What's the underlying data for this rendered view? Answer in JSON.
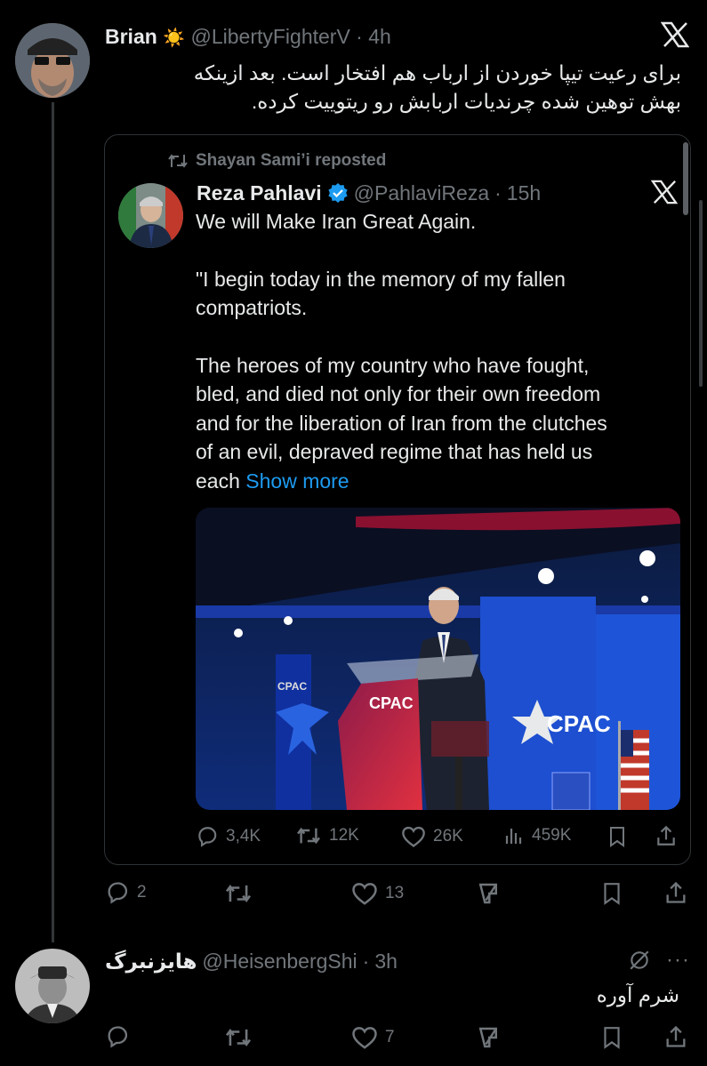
{
  "post1": {
    "display_name": "Brian",
    "name_emoji": "☀️",
    "handle": "@LibertyFighterV",
    "time": "4h",
    "text_line1": "برای رعیت تیپا خوردن از ارباب هم افتخار است. بعد ازینکه",
    "text_line2": "بهش توهین شده چرندیات اربابش رو ریتوییت کرده.",
    "stats": {
      "replies": "2",
      "retweets": "",
      "likes": "13"
    }
  },
  "quoted": {
    "repost_label": "Shayan Sami’i reposted",
    "display_name": "Reza Pahlavi",
    "handle": "@PahlaviReza",
    "time": "15h",
    "p1": "We will Make Iran Great Again.",
    "p2_l1": "\"I begin today in the memory of my fallen",
    "p2_l2": "compatriots.",
    "p3_l1": "The heroes of my country who have fought,",
    "p3_l2": "bled, and died not only for their own freedom",
    "p3_l3": "and for the liberation of Iran from the clutches",
    "p3_l4": "of an evil, depraved regime that has held us",
    "p3_l5": "each",
    "show_more": "Show more",
    "image_text": {
      "cpac_podium": "CPAC",
      "cpac_screen": "CPAC",
      "cpac_banner": "CPAC"
    },
    "stats": {
      "replies": "3,4K",
      "retweets": "12K",
      "likes": "26K",
      "views": "459K"
    }
  },
  "post2": {
    "display_name": "هایزنبرگ",
    "handle": "@HeisenbergShi",
    "time": "3h",
    "text": "شرم آوره",
    "stats": {
      "replies": "",
      "retweets": "",
      "likes": "7"
    }
  },
  "colors": {
    "background": "#000000",
    "text": "#e7e9ea",
    "muted": "#71767b",
    "link": "#1d9bf0",
    "verified": "#1d9bf0"
  }
}
